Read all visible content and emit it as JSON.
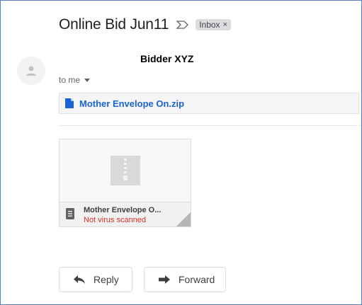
{
  "email": {
    "subject": "Online Bid Jun11",
    "label": "Inbox",
    "label_close": "×",
    "sender": "Bidder XYZ",
    "to": "to me"
  },
  "attachment": {
    "bar_name": "Mother Envelope On.zip",
    "card_name": "Mother Envelope O...",
    "card_status": "Not virus scanned"
  },
  "actions": {
    "reply": "Reply",
    "forward": "Forward"
  },
  "colors": {
    "link_blue": "#1a64d2",
    "warning_red": "#d93025"
  },
  "icons": [
    "important-marker-icon",
    "avatar-person-icon",
    "chevron-down-icon",
    "file-icon",
    "zip-icon",
    "document-icon",
    "reply-icon",
    "forward-icon"
  ]
}
